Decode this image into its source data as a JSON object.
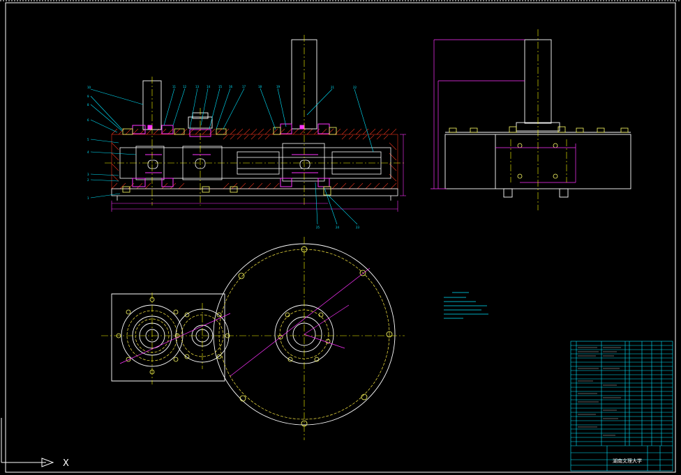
{
  "canvas": {
    "background": "#000000"
  },
  "colors": {
    "frame": "#ffffff",
    "outline": "#ffffff",
    "leader": "#00e5ff",
    "hatch": "#e8331c",
    "dimension": "#ff33ff",
    "centerline": "#ffff00",
    "pitch_circle": "#ffee44",
    "bolt": "#ffff66",
    "table_line": "#00e5ff"
  },
  "ucs": {
    "x_label": "X",
    "icon": "ucs-arrow-icon"
  },
  "title_block": {
    "institution": "湖南文理大学"
  }
}
